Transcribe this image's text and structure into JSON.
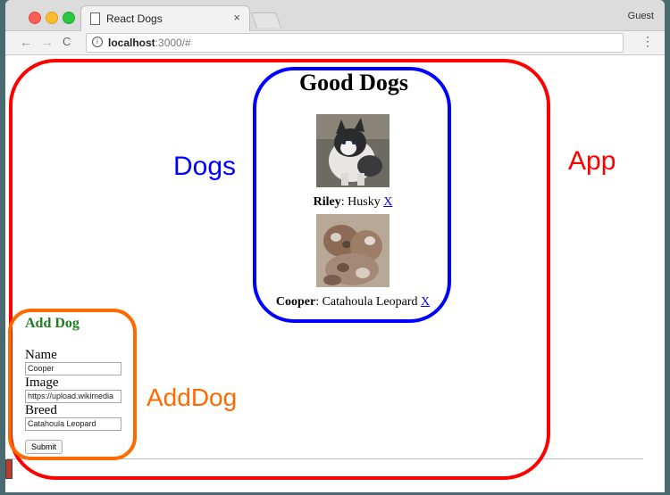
{
  "browser": {
    "tab_title": "React Dogs",
    "tab_close": "×",
    "profile": "Guest",
    "url_host": "localhost",
    "url_rest": ":3000/#",
    "back_glyph": "←",
    "forward_glyph": "→",
    "reload_glyph": "C",
    "menu_glyph": "⋮",
    "info_glyph": "i"
  },
  "app": {
    "heading": "Good Dogs",
    "dogs": [
      {
        "name": "Riley",
        "breed": ": Husky ",
        "remove": "X"
      },
      {
        "name": "Cooper",
        "breed": ": Catahoula Leopard ",
        "remove": "X"
      }
    ],
    "add_dog": {
      "heading": "Add Dog",
      "name_label": "Name",
      "name_value": "Cooper",
      "image_label": "Image",
      "image_value": "https://upload.wikimedia",
      "breed_label": "Breed",
      "breed_value": "Catahoula Leopard",
      "submit_label": "Submit"
    }
  },
  "annotations": {
    "dogs": "Dogs",
    "app": "App",
    "add_dog": "AddDog",
    "colors": {
      "app": "#ff0000",
      "dogs": "#0000ff",
      "add_dog": "#ff6a00"
    }
  }
}
